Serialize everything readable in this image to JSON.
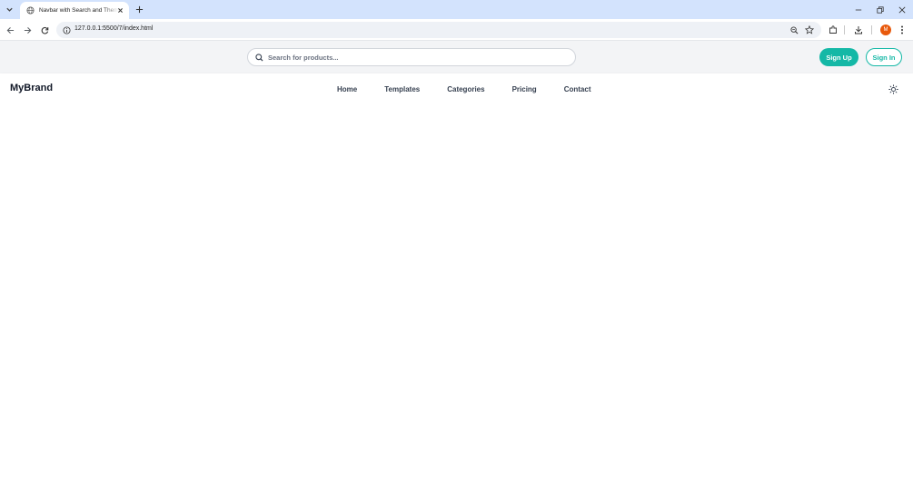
{
  "browser": {
    "tab_title": "Navbar with Search and Theme",
    "url": "127.0.0.1:5500/7/index.html",
    "profile_initial": "M",
    "profile_color": "#e8590c",
    "icons": [
      "tab-search-icon",
      "globe-icon",
      "close-icon",
      "plus-icon",
      "minimize-icon",
      "restore-icon",
      "back-icon",
      "forward-icon",
      "reload-icon",
      "site-info-icon",
      "zoom-icon",
      "star-icon",
      "extensions-icon",
      "download-icon",
      "kebab-menu-icon"
    ]
  },
  "header": {
    "search_placeholder": "Search for products...",
    "signup_label": "Sign Up",
    "signin_label": "Sign In",
    "accent_color": "#14b8a6"
  },
  "navbar": {
    "brand": "MyBrand",
    "links": [
      {
        "label": "Home"
      },
      {
        "label": "Templates"
      },
      {
        "label": "Categories"
      },
      {
        "label": "Pricing"
      },
      {
        "label": "Contact"
      }
    ],
    "theme_toggle_icon": "sun-icon"
  }
}
